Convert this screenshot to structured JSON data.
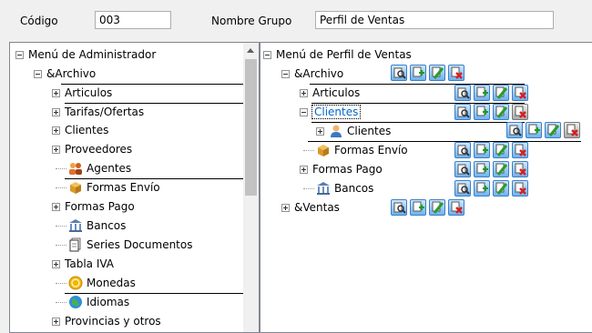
{
  "header": {
    "codigo_label": "Código",
    "codigo_value": "003",
    "nombre_label": "Nombre Grupo",
    "nombre_value": "Perfil de Ventas"
  },
  "left_tree": {
    "root": "Menú de Administrador",
    "archivo": "&Archivo",
    "articulos": "Articulos",
    "tarifas": "Tarifas/Ofertas",
    "clientes": "Clientes",
    "proveedores": "Proveedores",
    "agentes": "Agentes",
    "formas_envio": "Formas Envío",
    "formas_pago": "Formas Pago",
    "bancos": "Bancos",
    "series": "Series Documentos",
    "tabla_iva": "Tabla IVA",
    "monedas": "Monedas",
    "idiomas": "Idiomas",
    "provincias": "Provincias y otros"
  },
  "right_tree": {
    "root": "Menú de Perfil de Ventas",
    "archivo": "&Archivo",
    "articulos": "Articulos",
    "clientes_folder": "Clientes",
    "clientes_item": "Clientes",
    "formas_envio": "Formas Envío",
    "formas_pago": "Formas Pago",
    "bancos": "Bancos",
    "ventas": "&Ventas"
  },
  "icons": {
    "action_buttons": [
      "view-icon",
      "add-icon",
      "edit-icon",
      "delete-icon"
    ],
    "agentes": "agents-icon",
    "formas_envio": "box-icon",
    "bancos": "bank-icon",
    "series": "documents-icon",
    "monedas": "coin-icon",
    "idiomas": "globe-icon",
    "clientes": "user-icon"
  },
  "colors": {
    "selection_text": "#0066cc",
    "button_blue": "#6fb2ef"
  }
}
